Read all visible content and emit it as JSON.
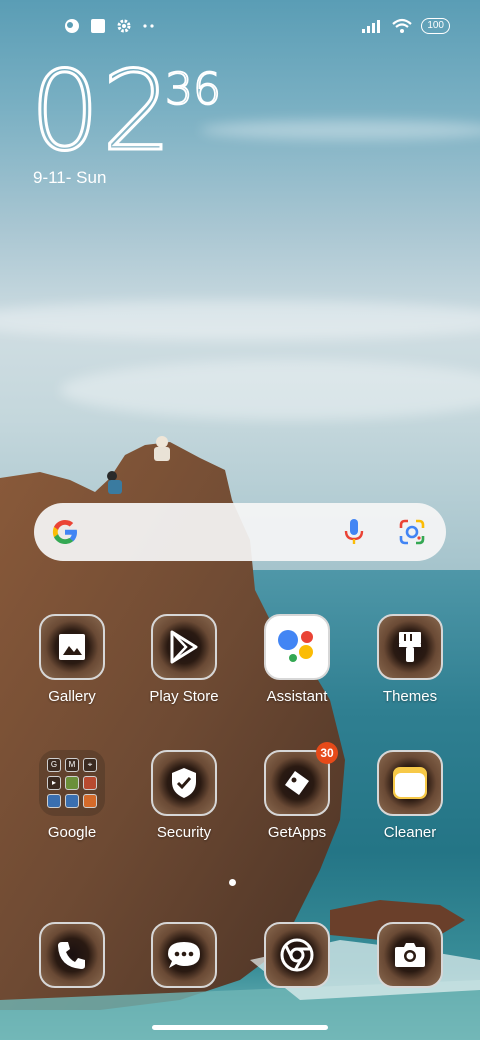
{
  "status_bar": {
    "battery": "100",
    "left_icons": [
      "app-circle-icon",
      "square-icon",
      "gear-icon",
      "more-dots-icon"
    ],
    "right_icons": [
      "signal-icon",
      "wifi-icon",
      "battery-icon"
    ]
  },
  "clock": {
    "hour": "02",
    "minute": "36",
    "date": "9-11- Sun"
  },
  "search": {
    "icons": [
      "google-icon",
      "mic-icon",
      "lens-icon"
    ]
  },
  "apps_row1": [
    {
      "label": "Gallery",
      "icon": "gallery-icon"
    },
    {
      "label": "Play Store",
      "icon": "play-store-icon"
    },
    {
      "label": "Assistant",
      "icon": "assistant-icon"
    },
    {
      "label": "Themes",
      "icon": "themes-icon"
    }
  ],
  "apps_row2": [
    {
      "label": "Google",
      "icon": "folder-icon"
    },
    {
      "label": "Security",
      "icon": "security-icon"
    },
    {
      "label": "GetApps",
      "icon": "getapps-icon",
      "badge": "30"
    },
    {
      "label": "Cleaner",
      "icon": "cleaner-icon"
    }
  ],
  "folder_minis": [
    "G",
    "M",
    "",
    "",
    "",
    "",
    "",
    "",
    ""
  ],
  "dock": [
    {
      "icon": "phone-icon"
    },
    {
      "icon": "messages-icon"
    },
    {
      "icon": "chrome-icon"
    },
    {
      "icon": "camera-icon"
    }
  ],
  "colors": {
    "badge": "#e64a19",
    "search_bg": "#f5f5f5"
  }
}
